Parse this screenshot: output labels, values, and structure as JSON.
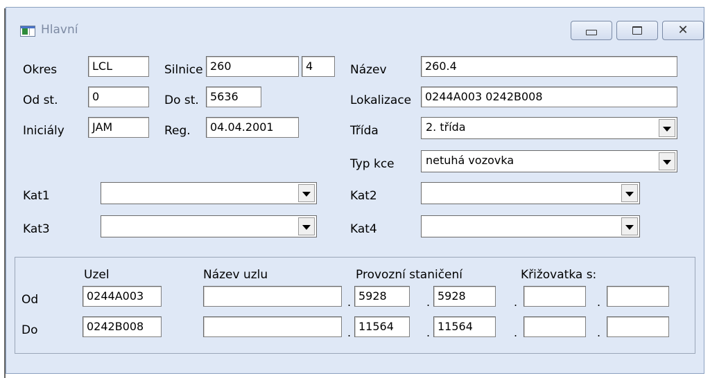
{
  "window": {
    "title": "Hlavní"
  },
  "form": {
    "okres": {
      "label": "Okres",
      "value": "LCL"
    },
    "silnice": {
      "label": "Silnice",
      "value1": "260",
      "value2": "4"
    },
    "nazev": {
      "label": "Název",
      "value": "260.4"
    },
    "od_st": {
      "label": "Od st.",
      "value": "0"
    },
    "do_st": {
      "label": "Do st.",
      "value": "5636"
    },
    "lokalizace": {
      "label": "Lokalizace",
      "value": "0244A003  0242B008"
    },
    "inicialy": {
      "label": "Iniciály",
      "value": "JAM"
    },
    "reg": {
      "label": "Reg.",
      "value": "04.04.2001"
    },
    "trida": {
      "label": "Třída",
      "value": "2. třída"
    },
    "typ_kce": {
      "label": "Typ kce",
      "value": "netuhá vozovka"
    },
    "kat1": {
      "label": "Kat1",
      "value": ""
    },
    "kat2": {
      "label": "Kat2",
      "value": ""
    },
    "kat3": {
      "label": "Kat3",
      "value": ""
    },
    "kat4": {
      "label": "Kat4",
      "value": ""
    }
  },
  "nodes": {
    "headers": {
      "uzel": "Uzel",
      "nazev_uzlu": "Název uzlu",
      "provozni": "Provozní staničení",
      "krizovatka": "Křižovatka s:"
    },
    "od": {
      "label": "Od",
      "uzel": "0244A003",
      "nazev": "",
      "st1": "5928",
      "st2": "5928",
      "kr1": "",
      "kr2": ""
    },
    "do": {
      "label": "Do",
      "uzel": "0242B008",
      "nazev": "",
      "st1": "11564",
      "st2": "11564",
      "kr1": "",
      "kr2": ""
    },
    "separator": "."
  }
}
